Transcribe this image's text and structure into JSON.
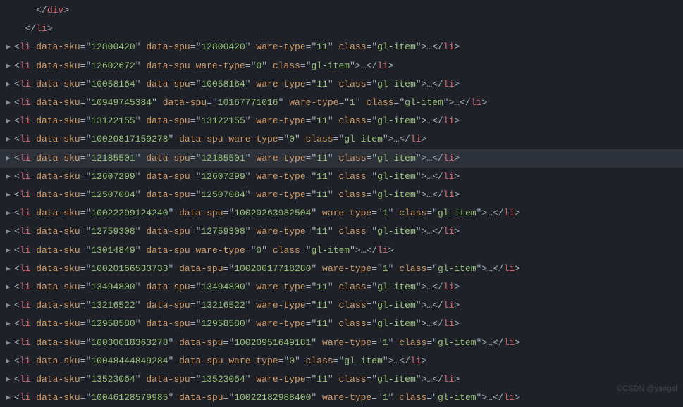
{
  "indentClose": [
    {
      "indent": "    ",
      "tag": "div"
    },
    {
      "indent": "  ",
      "tag": "li"
    }
  ],
  "rows": [
    {
      "sku": "12800420",
      "spu": "12800420",
      "ware": "11",
      "cls": "gl-item"
    },
    {
      "sku": "12602672",
      "spu": null,
      "ware": "0",
      "cls": "gl-item"
    },
    {
      "sku": "10058164",
      "spu": "10058164",
      "ware": "11",
      "cls": "gl-item"
    },
    {
      "sku": "10949745384",
      "spu": "10167771016",
      "ware": "1",
      "cls": "gl-item"
    },
    {
      "sku": "13122155",
      "spu": "13122155",
      "ware": "11",
      "cls": "gl-item"
    },
    {
      "sku": "10020817159278",
      "spu": null,
      "ware": "0",
      "cls": "gl-item"
    },
    {
      "sku": "12185501",
      "spu": "12185501",
      "ware": "11",
      "cls": "gl-item",
      "hl": true
    },
    {
      "sku": "12607299",
      "spu": "12607299",
      "ware": "11",
      "cls": "gl-item"
    },
    {
      "sku": "12507084",
      "spu": "12507084",
      "ware": "11",
      "cls": "gl-item"
    },
    {
      "sku": "10022299124240",
      "spu": "10020263982504",
      "ware": "1",
      "cls": "gl-item"
    },
    {
      "sku": "12759308",
      "spu": "12759308",
      "ware": "11",
      "cls": "gl-item"
    },
    {
      "sku": "13014849",
      "spu": null,
      "ware": "0",
      "cls": "gl-item"
    },
    {
      "sku": "10020166533733",
      "spu": "10020017718280",
      "ware": "1",
      "cls": "gl-item"
    },
    {
      "sku": "13494800",
      "spu": "13494800",
      "ware": "11",
      "cls": "gl-item"
    },
    {
      "sku": "13216522",
      "spu": "13216522",
      "ware": "11",
      "cls": "gl-item"
    },
    {
      "sku": "12958580",
      "spu": "12958580",
      "ware": "11",
      "cls": "gl-item"
    },
    {
      "sku": "10030018363278",
      "spu": "10020951649181",
      "ware": "1",
      "cls": "gl-item"
    },
    {
      "sku": "10048444849284",
      "spu": null,
      "ware": "0",
      "cls": "gl-item"
    },
    {
      "sku": "13523064",
      "spu": "13523064",
      "ware": "11",
      "cls": "gl-item"
    },
    {
      "sku": "10046128579985",
      "spu": "10022182988400",
      "ware": "1",
      "cls": "gl-item"
    }
  ],
  "labels": {
    "data_sku": "data-sku",
    "data_spu": "data-spu",
    "ware_type": "ware-type",
    "class": "class",
    "li": "li",
    "ellipsis": "…"
  },
  "watermark": "©CSDN @yangsf"
}
